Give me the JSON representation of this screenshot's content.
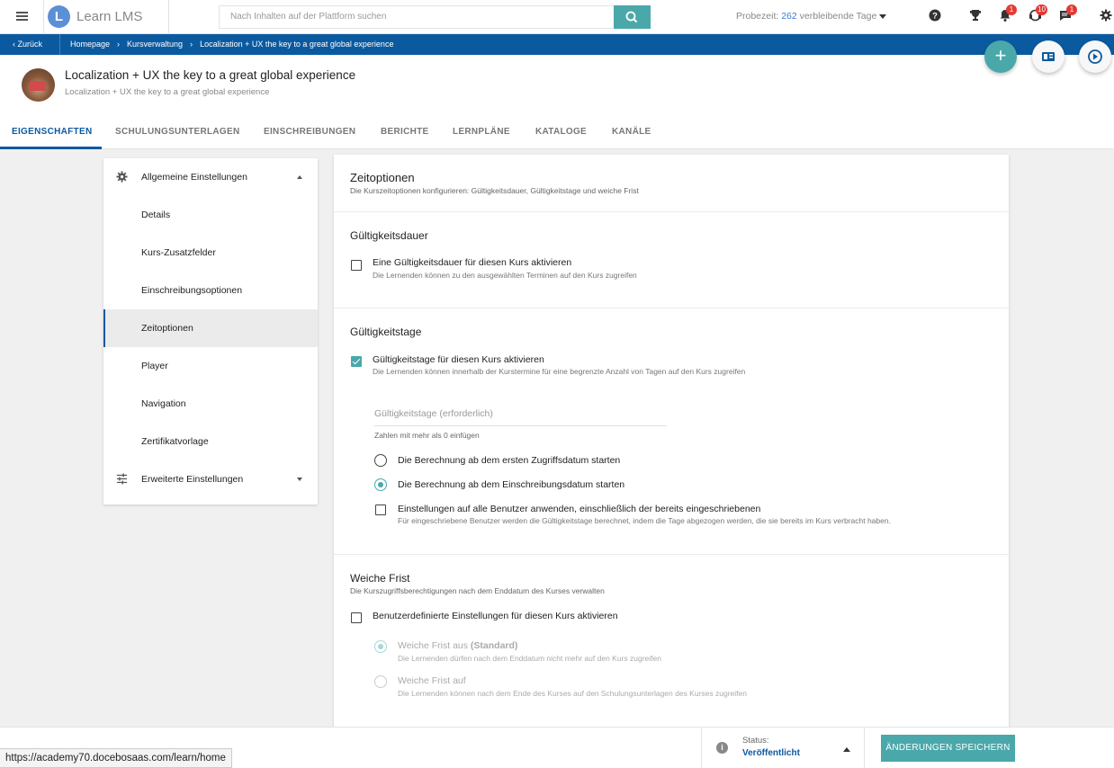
{
  "topbar": {
    "logo_text": "Learn LMS",
    "search_placeholder": "Nach Inhalten auf der Plattform suchen",
    "trial_prefix": "Probezeit:",
    "trial_days": "262",
    "trial_suffix": "verbleibende Tage",
    "badges": {
      "notifications": "1",
      "messages": "10",
      "chat": "1"
    }
  },
  "breadcrumb": {
    "back": "Zurück",
    "items": [
      "Homepage",
      "Kursverwaltung",
      "Localization + UX the key to a great global experience"
    ]
  },
  "course": {
    "title": "Localization + UX the key to a great global experience",
    "subtitle": "Localization + UX the key to a great global experience"
  },
  "tabs": [
    "EIGENSCHAFTEN",
    "SCHULUNGSUNTERLAGEN",
    "EINSCHREIBUNGEN",
    "BERICHTE",
    "LERNPLÄNE",
    "KATALOGE",
    "KANÄLE"
  ],
  "leftnav": {
    "general": "Allgemeine Einstellungen",
    "items": [
      "Details",
      "Kurs-Zusatzfelder",
      "Einschreibungsoptionen",
      "Zeitoptionen",
      "Player",
      "Navigation",
      "Zertifikatvorlage"
    ],
    "advanced": "Erweiterte Einstellungen"
  },
  "main": {
    "title": "Zeitoptionen",
    "description": "Die Kurszeitoptionen konfigurieren: Gültigkeitsdauer, Gültigkeitstage und weiche Frist",
    "validity_period": {
      "heading": "Gültigkeitsdauer",
      "checkbox_label": "Eine Gültigkeitsdauer für diesen Kurs aktivieren",
      "checkbox_desc": "Die Lernenden können zu den ausgewählten Terminen auf den Kurs zugreifen"
    },
    "validity_days": {
      "heading": "Gültigkeitstage",
      "checkbox_label": "Gültigkeitstage für diesen Kurs aktivieren",
      "checkbox_desc": "Die Lernenden können innerhalb der Kurstermine für eine begrenzte Anzahl von Tagen auf den Kurs zugreifen",
      "field_placeholder": "Gültigkeitstage  (erforderlich)",
      "field_hint": "Zahlen mit mehr als 0 einfügen",
      "radio_first_access": "Die Berechnung ab dem ersten Zugriffsdatum starten",
      "radio_enrollment": "Die Berechnung ab dem Einschreibungsdatum starten",
      "apply_all_label": "Einstellungen auf alle Benutzer anwenden, einschließlich der bereits eingeschriebenen",
      "apply_all_desc": "Für eingeschriebene Benutzer werden die Gültigkeitstage berechnet, indem die Tage abgezogen werden, die sie bereits im Kurs verbracht haben."
    },
    "soft_deadline": {
      "heading": "Weiche Frist",
      "description": "Die Kurszugriffsberechtigungen nach dem Enddatum des Kurses verwalten",
      "checkbox_label": "Benutzerdefinierte Einstellungen für diesen Kurs aktivieren",
      "off_label": "Weiche Frist aus",
      "off_suffix": "(Standard)",
      "off_desc": "Die Lernenden dürfen nach dem Enddatum nicht mehr auf den Kurs zugreifen",
      "on_label": "Weiche Frist auf",
      "on_desc": "Die Lernenden können nach dem Ende des Kurses auf den Schulungsunterlagen des Kurses zugreifen"
    }
  },
  "bottombar": {
    "status_label": "Status:",
    "status_value": "Veröffentlicht",
    "save_button": "ÄNDERUNGEN SPEICHERN"
  },
  "browser": {
    "status_url": "https://academy70.docebosaas.com/learn/home"
  },
  "colors": {
    "accent": "#4aa8aa",
    "brand_blue": "#0b5aa0",
    "badge_red": "#e53935"
  }
}
